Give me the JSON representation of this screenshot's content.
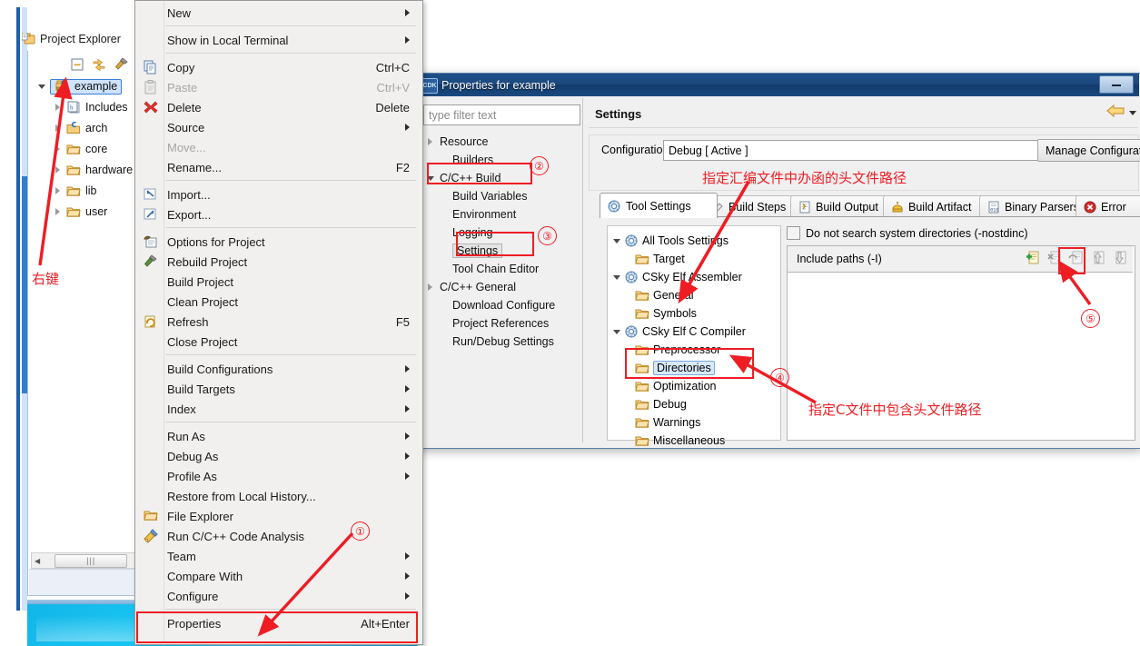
{
  "ide": {
    "explorer": {
      "title": "Project Explorer",
      "toolbar_icons": [
        "collapse-all-icon",
        "link-with-editor-icon",
        "build-hammer-icon"
      ],
      "tree": [
        {
          "label": "example",
          "icon": "c-project-icon",
          "twisty": "open",
          "indent": 0,
          "selected": true
        },
        {
          "label": "Includes",
          "icon": "includes-icon",
          "twisty": "closed",
          "indent": 1,
          "selected": false
        },
        {
          "label": "arch",
          "icon": "source-folder-icon",
          "twisty": "closed",
          "indent": 1,
          "selected": false
        },
        {
          "label": "core",
          "icon": "folder-icon",
          "twisty": "closed",
          "indent": 1,
          "selected": false
        },
        {
          "label": "hardware",
          "icon": "folder-icon",
          "twisty": "closed",
          "indent": 1,
          "selected": false
        },
        {
          "label": "lib",
          "icon": "folder-icon",
          "twisty": "closed",
          "indent": 1,
          "selected": false
        },
        {
          "label": "user",
          "icon": "folder-icon",
          "twisty": "closed",
          "indent": 1,
          "selected": false
        }
      ]
    }
  },
  "context_menu": {
    "items": [
      {
        "label": "New",
        "accel": "",
        "arrow": true,
        "icon": "",
        "disabled": false,
        "sep_after": true
      },
      {
        "label": "Show in Local Terminal",
        "accel": "",
        "arrow": true,
        "icon": "",
        "disabled": false,
        "sep_after": true
      },
      {
        "label": "Copy",
        "accel": "Ctrl+C",
        "arrow": false,
        "icon": "copy-icon",
        "disabled": false,
        "sep_after": false
      },
      {
        "label": "Paste",
        "accel": "Ctrl+V",
        "arrow": false,
        "icon": "paste-icon",
        "disabled": true,
        "sep_after": false
      },
      {
        "label": "Delete",
        "accel": "Delete",
        "arrow": false,
        "icon": "delete-x-icon",
        "disabled": false,
        "sep_after": false
      },
      {
        "label": "Source",
        "accel": "",
        "arrow": true,
        "icon": "",
        "disabled": false,
        "sep_after": false
      },
      {
        "label": "Move...",
        "accel": "",
        "arrow": false,
        "icon": "",
        "disabled": true,
        "sep_after": false
      },
      {
        "label": "Rename...",
        "accel": "F2",
        "arrow": false,
        "icon": "",
        "disabled": false,
        "sep_after": true
      },
      {
        "label": "Import...",
        "accel": "",
        "arrow": false,
        "icon": "import-icon",
        "disabled": false,
        "sep_after": false
      },
      {
        "label": "Export...",
        "accel": "",
        "arrow": false,
        "icon": "export-icon",
        "disabled": false,
        "sep_after": true
      },
      {
        "label": "Options for Project",
        "accel": "",
        "arrow": false,
        "icon": "options-icon",
        "disabled": false,
        "sep_after": false
      },
      {
        "label": "Rebuild Project",
        "accel": "",
        "arrow": false,
        "icon": "rebuild-hammer-icon",
        "disabled": false,
        "sep_after": false
      },
      {
        "label": "Build Project",
        "accel": "",
        "arrow": false,
        "icon": "",
        "disabled": false,
        "sep_after": false
      },
      {
        "label": "Clean Project",
        "accel": "",
        "arrow": false,
        "icon": "",
        "disabled": false,
        "sep_after": false
      },
      {
        "label": "Refresh",
        "accel": "F5",
        "arrow": false,
        "icon": "refresh-icon",
        "disabled": false,
        "sep_after": false
      },
      {
        "label": "Close Project",
        "accel": "",
        "arrow": false,
        "icon": "",
        "disabled": false,
        "sep_after": true
      },
      {
        "label": "Build Configurations",
        "accel": "",
        "arrow": true,
        "icon": "",
        "disabled": false,
        "sep_after": false
      },
      {
        "label": "Build Targets",
        "accel": "",
        "arrow": true,
        "icon": "",
        "disabled": false,
        "sep_after": false
      },
      {
        "label": "Index",
        "accel": "",
        "arrow": true,
        "icon": "",
        "disabled": false,
        "sep_after": true
      },
      {
        "label": "Run As",
        "accel": "",
        "arrow": true,
        "icon": "",
        "disabled": false,
        "sep_after": false
      },
      {
        "label": "Debug As",
        "accel": "",
        "arrow": true,
        "icon": "",
        "disabled": false,
        "sep_after": false
      },
      {
        "label": "Profile As",
        "accel": "",
        "arrow": true,
        "icon": "",
        "disabled": false,
        "sep_after": false
      },
      {
        "label": "Restore from Local History...",
        "accel": "",
        "arrow": false,
        "icon": "",
        "disabled": false,
        "sep_after": false
      },
      {
        "label": "File Explorer",
        "accel": "",
        "arrow": false,
        "icon": "open-folder-icon",
        "disabled": false,
        "sep_after": false
      },
      {
        "label": "Run C/C++ Code Analysis",
        "accel": "",
        "arrow": false,
        "icon": "code-analysis-icon",
        "disabled": false,
        "sep_after": false
      },
      {
        "label": "Team",
        "accel": "",
        "arrow": true,
        "icon": "",
        "disabled": false,
        "sep_after": false
      },
      {
        "label": "Compare With",
        "accel": "",
        "arrow": true,
        "icon": "",
        "disabled": false,
        "sep_after": false
      },
      {
        "label": "Configure",
        "accel": "",
        "arrow": true,
        "icon": "",
        "disabled": false,
        "sep_after": true
      },
      {
        "label": "Properties",
        "accel": "Alt+Enter",
        "arrow": false,
        "icon": "",
        "disabled": false,
        "sep_after": false
      }
    ]
  },
  "properties_dialog": {
    "title": "Properties for example",
    "filter_placeholder": "type filter text",
    "nav_items": [
      {
        "label": "Resource",
        "twisty": "closed",
        "indent": 0,
        "selected": false
      },
      {
        "label": "Builders",
        "twisty": "none",
        "indent": 1,
        "selected": false
      },
      {
        "label": "C/C++ Build",
        "twisty": "open",
        "indent": 0,
        "selected": false
      },
      {
        "label": "Build Variables",
        "twisty": "none",
        "indent": 1,
        "selected": false
      },
      {
        "label": "Environment",
        "twisty": "none",
        "indent": 1,
        "selected": false
      },
      {
        "label": "Logging",
        "twisty": "none",
        "indent": 1,
        "selected": false
      },
      {
        "label": "Settings",
        "twisty": "none",
        "indent": 1,
        "selected": true
      },
      {
        "label": "Tool Chain Editor",
        "twisty": "none",
        "indent": 1,
        "selected": false
      },
      {
        "label": "C/C++ General",
        "twisty": "closed",
        "indent": 0,
        "selected": false
      },
      {
        "label": "Download Configure",
        "twisty": "none",
        "indent": 1,
        "selected": false
      },
      {
        "label": "Project References",
        "twisty": "none",
        "indent": 1,
        "selected": false
      },
      {
        "label": "Run/Debug Settings",
        "twisty": "none",
        "indent": 1,
        "selected": false
      }
    ],
    "page_title": "Settings",
    "configuration_label": "Configuration:",
    "configuration_value": "Debug  [ Active ]",
    "manage_button": "Manage Configurat",
    "tabs": [
      {
        "label": "Tool Settings",
        "icon": "tool-settings-icon",
        "active": true
      },
      {
        "label": "Build Steps",
        "icon": "build-steps-icon",
        "active": false
      },
      {
        "label": "Build Output",
        "icon": "build-output-icon",
        "active": false
      },
      {
        "label": "Build Artifact",
        "icon": "build-artifact-icon",
        "active": false
      },
      {
        "label": "Binary Parsers",
        "icon": "binary-parsers-icon",
        "active": false
      },
      {
        "label": "Error",
        "icon": "error-parsers-icon",
        "active": false
      }
    ],
    "tool_tree": [
      {
        "label": "All Tools Settings",
        "icon": "tools-icon",
        "twisty": "open",
        "indent": 0,
        "selected": false
      },
      {
        "label": "Target",
        "icon": "folder-icon",
        "twisty": "none",
        "indent": 1,
        "selected": false
      },
      {
        "label": "CSky Elf Assembler",
        "icon": "tools-icon",
        "twisty": "open",
        "indent": 0,
        "selected": false
      },
      {
        "label": "General",
        "icon": "folder-icon",
        "twisty": "none",
        "indent": 1,
        "selected": false
      },
      {
        "label": "Symbols",
        "icon": "folder-icon",
        "twisty": "none",
        "indent": 1,
        "selected": false
      },
      {
        "label": "CSky Elf C Compiler",
        "icon": "tools-icon",
        "twisty": "open",
        "indent": 0,
        "selected": false
      },
      {
        "label": "Preprocessor",
        "icon": "folder-icon",
        "twisty": "none",
        "indent": 1,
        "selected": false
      },
      {
        "label": "Directories",
        "icon": "folder-icon",
        "twisty": "none",
        "indent": 1,
        "selected": true
      },
      {
        "label": "Optimization",
        "icon": "folder-icon",
        "twisty": "none",
        "indent": 1,
        "selected": false
      },
      {
        "label": "Debug",
        "icon": "folder-icon",
        "twisty": "none",
        "indent": 1,
        "selected": false
      },
      {
        "label": "Warnings",
        "icon": "folder-icon",
        "twisty": "none",
        "indent": 1,
        "selected": false
      },
      {
        "label": "Miscellaneous",
        "icon": "folder-icon",
        "twisty": "none",
        "indent": 1,
        "selected": false
      }
    ],
    "nostdinc_label": "Do not search system directories (-nostdinc)",
    "nostdinc_checked": false,
    "include_paths_label": "Include paths (-I)",
    "include_paths_items": [],
    "list_buttons": [
      "add-icon",
      "delete-icon",
      "edit-icon",
      "move-up-icon",
      "move-down-icon"
    ]
  },
  "annotations": {
    "color": "#ee1d24",
    "right_click_note": "右键",
    "asm_include_note": "指定汇编文件中办函的头文件路径",
    "c_include_note": "指定C文件中包含头文件路径",
    "step_1": "①",
    "step_2": "②",
    "step_3": "③",
    "step_4": "④",
    "step_5": "⑤"
  }
}
